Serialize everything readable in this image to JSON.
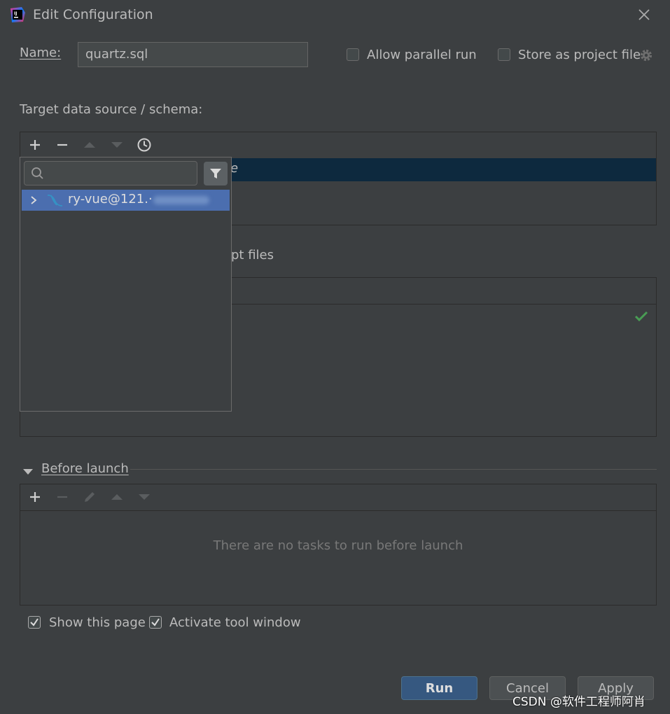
{
  "dialog": {
    "title": "Edit Configuration"
  },
  "name_row": {
    "label": "Name:",
    "value": "quartz.sql",
    "allow_parallel_label": "Allow parallel run",
    "store_project_label": "Store as project file"
  },
  "target": {
    "label": "Target data source / schema:",
    "selected_suffix": "e"
  },
  "popup": {
    "search_placeholder": "",
    "tree_item": "ry-vue@121.·"
  },
  "scripts": {
    "label_suffix": "pt files"
  },
  "before_launch": {
    "label": "Before launch",
    "empty_text": "There are no tasks to run before launch"
  },
  "options": {
    "show_page": "Show this page",
    "activate_tool": "Activate tool window"
  },
  "buttons": {
    "run": "Run",
    "cancel": "Cancel",
    "apply": "Apply"
  },
  "watermark": "CSDN @软件工程师阿肖",
  "colors": {
    "background": "#3c3f41",
    "selection": "#0d293e",
    "tree_selection": "#4b6eaf",
    "primary_button": "#365880",
    "check_green": "#499c54"
  }
}
